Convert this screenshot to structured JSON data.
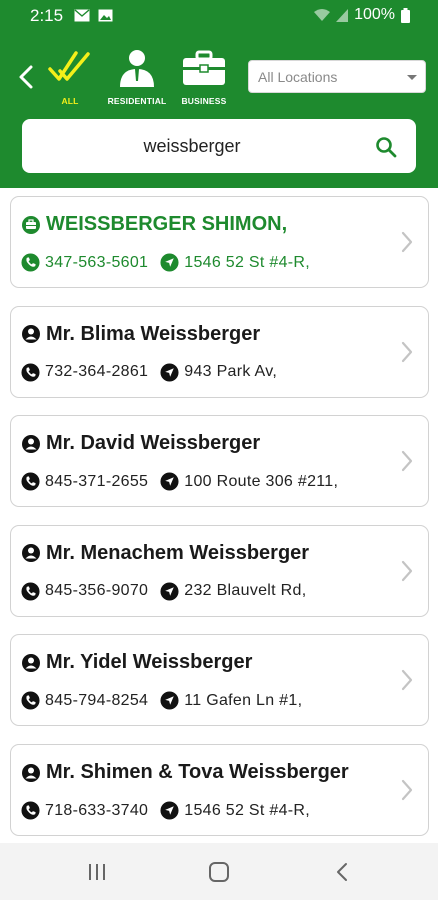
{
  "status": {
    "time": "2:15",
    "battery": "100%"
  },
  "categories": [
    {
      "label": "ALL",
      "icon": "double-check-icon",
      "active": true
    },
    {
      "label": "RESIDENTIAL",
      "icon": "person-icon",
      "active": false
    },
    {
      "label": "BUSINESS",
      "icon": "briefcase-icon",
      "active": false
    }
  ],
  "location": {
    "placeholder": "All Locations"
  },
  "search": {
    "value": "weissberger"
  },
  "colors": {
    "brand": "#1e8a2e",
    "active": "#f4ef1a"
  },
  "results": [
    {
      "name": "WEISSBERGER SHIMON,",
      "phone": "347-563-5601",
      "address": "1546 52 St #4-R,",
      "type": "business"
    },
    {
      "name": "Mr. Blima  Weissberger",
      "phone": "732-364-2861",
      "address": "943 Park Av,",
      "type": "residential"
    },
    {
      "name": "Mr. David Weissberger",
      "phone": "845-371-2655",
      "address": "100 Route 306 #211,",
      "type": "residential"
    },
    {
      "name": "Mr. Menachem Weissberger",
      "phone": "845-356-9070",
      "address": "232 Blauvelt Rd,",
      "type": "residential"
    },
    {
      "name": "Mr. Yidel Weissberger",
      "phone": "845-794-8254",
      "address": "11 Gafen Ln #1,",
      "type": "residential"
    },
    {
      "name": "Mr. Shimen & Tova Weissberger",
      "phone": "718-633-3740",
      "address": "1546 52 St #4-R,",
      "type": "residential"
    }
  ]
}
